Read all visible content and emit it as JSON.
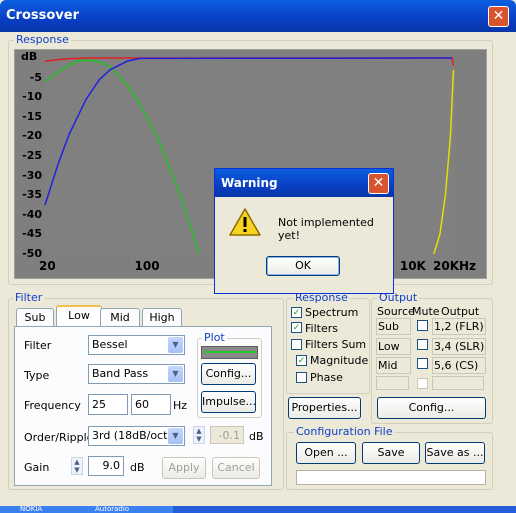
{
  "window": {
    "title": "Crossover"
  },
  "response_group": {
    "label": "Response",
    "chart_data": {
      "type": "line",
      "ylabel": "dB",
      "y_ticks": [
        "-5",
        "-10",
        "-15",
        "-20",
        "-25",
        "-30",
        "-35",
        "-40",
        "-45",
        "-50"
      ],
      "x_ticks": [
        "20",
        "100",
        "10K",
        "20KHz"
      ],
      "ylim": [
        -50,
        0
      ],
      "xlim": [
        20,
        20000
      ],
      "x_scale": "log",
      "series": [
        {
          "color": "#e02020",
          "x": [
            20,
            25,
            30,
            35,
            40,
            500,
            19000,
            19500
          ],
          "y": [
            -0.8,
            -0.4,
            -0.2,
            -0.1,
            0,
            0,
            0,
            -2
          ]
        },
        {
          "color": "#20c020",
          "x": [
            20,
            25,
            30,
            35,
            40,
            50,
            60,
            80,
            100,
            140,
            200,
            270
          ],
          "y": [
            -6,
            -3.5,
            -1.8,
            -0.8,
            -0.5,
            -1,
            -2.2,
            -7,
            -12,
            -22,
            -36,
            -50
          ]
        },
        {
          "color": "#2020e0",
          "x": [
            20,
            25,
            30,
            40,
            50,
            60,
            80,
            100,
            19000
          ],
          "y": [
            -37.5,
            -27,
            -19.5,
            -10.5,
            -5.5,
            -3,
            -0.8,
            -0.1,
            0
          ]
        },
        {
          "color": "#e0e000",
          "x": [
            14000,
            15500,
            17000,
            18500,
            19500
          ],
          "y": [
            -50,
            -45,
            -35,
            -20,
            -3
          ]
        }
      ]
    }
  },
  "filter_group": {
    "label": "Filter",
    "tabs": [
      "Sub",
      "Low",
      "Mid",
      "High"
    ],
    "active_tab": "Low",
    "filter_label": "Filter",
    "filter_value": "Bessel",
    "type_label": "Type",
    "type_value": "Band Pass",
    "frequency_label": "Frequency",
    "frequency_low": "25",
    "frequency_high": "60",
    "frequency_unit": "Hz",
    "order_label": "Order/Ripple",
    "order_value": "3rd (18dB/oct)",
    "ripple_value": "-0.1",
    "ripple_unit": "dB",
    "gain_label": "Gain",
    "gain_value": "9.0",
    "gain_unit": "dB",
    "apply_label": "Apply",
    "cancel_label": "Cancel",
    "plot_label": "Plot",
    "plot_swatch_color": "#22cc22",
    "config_label": "Config...",
    "impulse_label": "Impulse..."
  },
  "response_options": {
    "label": "Response",
    "spectrum": {
      "label": "Spectrum",
      "checked": true
    },
    "filters": {
      "label": "Filters",
      "checked": true
    },
    "filters_sum": {
      "label": "Filters Sum",
      "checked": false
    },
    "magnitude": {
      "label": "Magnitude",
      "checked": true
    },
    "phase": {
      "label": "Phase",
      "checked": false
    },
    "properties_label": "Properties..."
  },
  "output_group": {
    "label": "Output",
    "headers": [
      "Source",
      "Mute",
      "Output"
    ],
    "rows": [
      {
        "source": "Sub",
        "output": "1,2 (FLR)"
      },
      {
        "source": "Low",
        "output": "3,4 (SLR)"
      },
      {
        "source": "Mid",
        "output": "5,6 (CS)"
      }
    ],
    "config_label": "Config..."
  },
  "config_file": {
    "label": "Configuration File",
    "open_label": "Open ...",
    "save_label": "Save",
    "save_as_label": "Save as ..."
  },
  "dialog": {
    "title": "Warning",
    "message": "Not implemented yet!",
    "ok_label": "OK"
  },
  "taskbar": {
    "items": [
      "NOKIA",
      "Autoradio"
    ]
  }
}
